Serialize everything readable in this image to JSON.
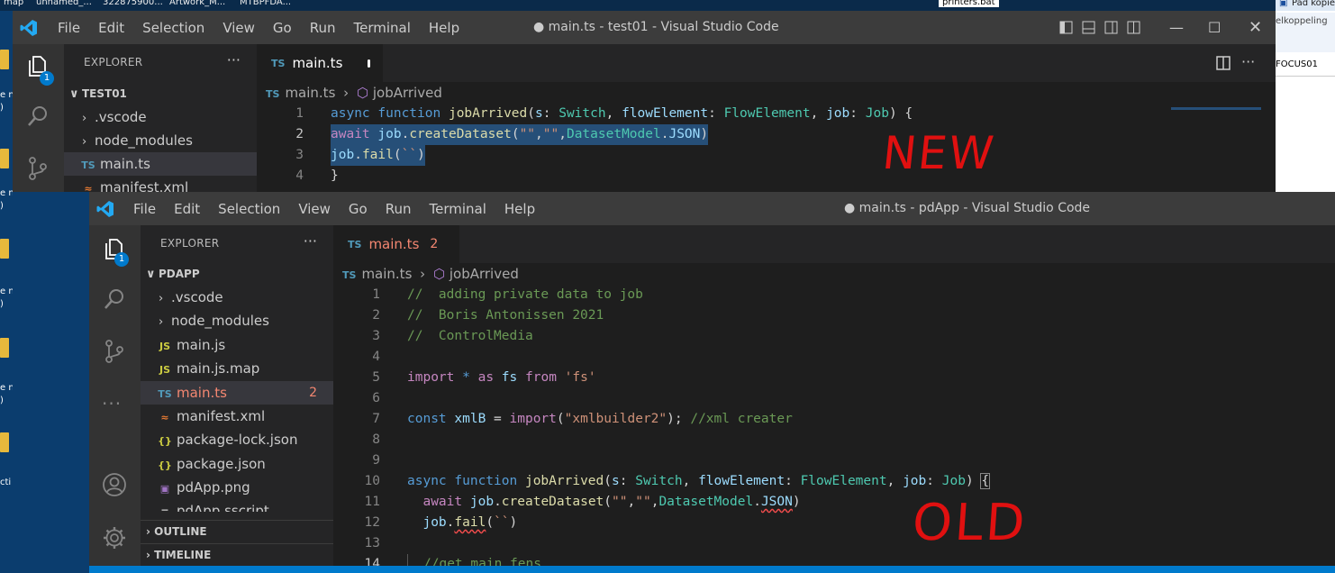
{
  "desktop": {
    "top_labels": [
      "map",
      "unnamed_...",
      "322875900...",
      "Artwork_M...",
      "MTBPFDA...",
      "printers.bat"
    ],
    "right_pane": [
      "Pad kopiëren",
      "elkoppeling",
      "FOCUS01"
    ],
    "left_labels": [
      "e n",
      ")",
      "e n",
      ")",
      "e n",
      ")",
      "e n",
      ")",
      "e n",
      ")",
      "cti"
    ]
  },
  "back_window": {
    "menu": [
      "File",
      "Edit",
      "Selection",
      "View",
      "Go",
      "Run",
      "Terminal",
      "Help"
    ],
    "title": "● main.ts - test01 - Visual Studio Code",
    "explorer_title": "EXPLORER",
    "badge": "1",
    "root": "TEST01",
    "tree": [
      {
        "label": ".vscode",
        "kind": "folder"
      },
      {
        "label": "node_modules",
        "kind": "folder"
      },
      {
        "label": "main.ts",
        "kind": "ts"
      },
      {
        "label": "manifest.xml",
        "kind": "xml"
      }
    ],
    "tab": {
      "label": "main.ts",
      "icon": "TS"
    },
    "breadcrumb": {
      "file": "main.ts",
      "symbol": "jobArrived"
    },
    "lines": [
      "1",
      "2",
      "3",
      "4"
    ],
    "annotation": "NEW"
  },
  "front_window": {
    "menu": [
      "File",
      "Edit",
      "Selection",
      "View",
      "Go",
      "Run",
      "Terminal",
      "Help"
    ],
    "title": "● main.ts - pdApp - Visual Studio Code",
    "explorer_title": "EXPLORER",
    "badge": "1",
    "root": "PDAPP",
    "tree": [
      {
        "label": ".vscode",
        "kind": "folder"
      },
      {
        "label": "node_modules",
        "kind": "folder"
      },
      {
        "label": "main.js",
        "kind": "js"
      },
      {
        "label": "main.js.map",
        "kind": "js"
      },
      {
        "label": "main.ts",
        "kind": "ts",
        "errors": "2"
      },
      {
        "label": "manifest.xml",
        "kind": "xml"
      },
      {
        "label": "package-lock.json",
        "kind": "json"
      },
      {
        "label": "package.json",
        "kind": "json"
      },
      {
        "label": "pdApp.png",
        "kind": "png"
      },
      {
        "label": "pdApp.sscript",
        "kind": "script"
      }
    ],
    "outline": "OUTLINE",
    "timeline": "TIMELINE",
    "tab": {
      "label": "main.ts",
      "icon": "TS",
      "errors": "2"
    },
    "breadcrumb": {
      "file": "main.ts",
      "symbol": "jobArrived"
    },
    "lines": [
      "1",
      "2",
      "3",
      "4",
      "5",
      "6",
      "7",
      "8",
      "9",
      "10",
      "11",
      "12",
      "13",
      "14"
    ],
    "annotation": "OLD"
  },
  "icons": {
    "files": "files-icon",
    "search": "search-icon",
    "scm": "source-control-icon",
    "debug": "run-debug-icon",
    "extensions": "extensions-icon",
    "accounts": "accounts-icon",
    "settings": "gear-icon"
  },
  "colors": {
    "accent": "#007acc",
    "titlebar": "#3c3c3c",
    "editor": "#1e1e1e",
    "sidebar": "#252526",
    "activity": "#333333",
    "annotation": "#e01010"
  }
}
